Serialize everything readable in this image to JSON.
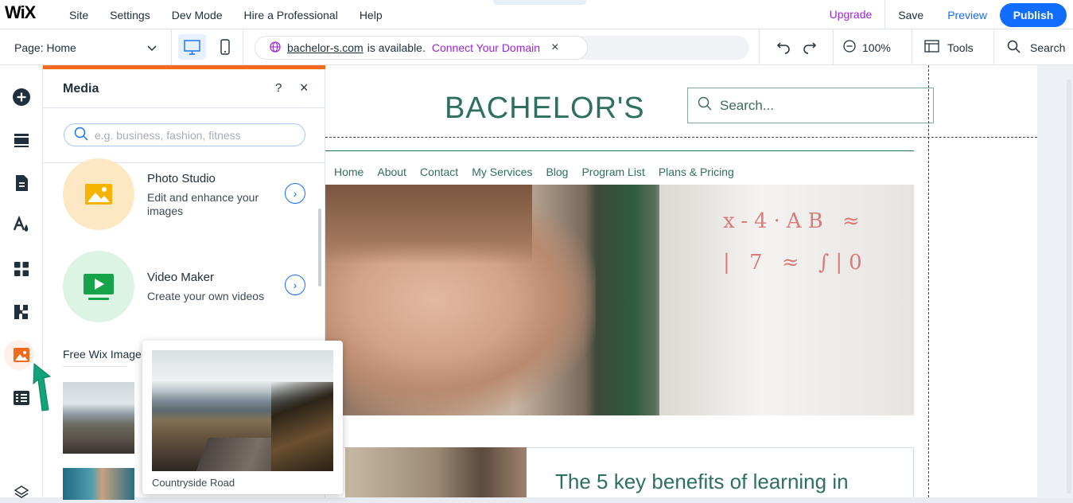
{
  "topbar": {
    "logo": "WiX",
    "menu": [
      "Site",
      "Settings",
      "Dev Mode",
      "Hire a Professional",
      "Help"
    ],
    "upgrade": "Upgrade",
    "save": "Save",
    "preview": "Preview",
    "publish": "Publish"
  },
  "secondbar": {
    "page_select": "Page: Home",
    "domain_name": "bachelor-s.com",
    "domain_status": "is available.",
    "connect_domain": "Connect Your Domain",
    "zoom": "100%",
    "tools": "Tools",
    "search": "Search"
  },
  "media_panel": {
    "title": "Media",
    "help": "?",
    "close": "×",
    "search_placeholder": "e.g. business, fashion, fitness",
    "cards": [
      {
        "title": "Photo Studio",
        "subtitle": "Edit and enhance your images"
      },
      {
        "title": "Video Maker",
        "subtitle": "Create your own videos"
      }
    ],
    "section_title": "Free Wix Image",
    "tooltip_caption": "Countryside Road"
  },
  "site": {
    "brand": "BACHELOR'S",
    "search_placeholder": "Search...",
    "nav": [
      "Home",
      "About",
      "Contact",
      "My Services",
      "Blog",
      "Program List",
      "Plans & Pricing"
    ],
    "article_title": "The 5 key benefits of learning in",
    "whiteboard_marks": "x-4·AB  ≈ |  7  ≈ ∫|0"
  },
  "colors": {
    "accent": "#116dff",
    "upgrade": "#9a27d5",
    "media_accent": "#f26b1d",
    "site_green": "#2e7060"
  }
}
